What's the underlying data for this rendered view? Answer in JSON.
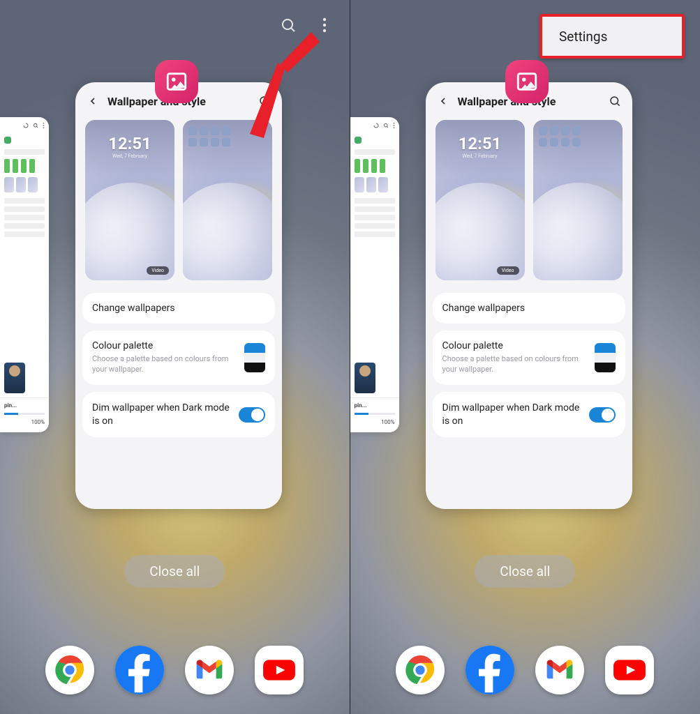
{
  "topbar": {
    "search_icon": "search",
    "more_icon": "more"
  },
  "popup": {
    "settings_label": "Settings"
  },
  "recents": {
    "app_icon_name": "gallery-icon",
    "close_all_label": "Close all",
    "card": {
      "title": "Wallpaper and style",
      "lock_time": "12:51",
      "lock_date": "Wed, 7 February",
      "video_badge": "Video",
      "change_wallpapers_label": "Change wallpapers",
      "colour_palette_label": "Colour palette",
      "colour_palette_desc": "Choose a palette based on colours from your wallpaper.",
      "palette_colors": [
        "#1a84d6",
        "#eef0f2",
        "#111111"
      ],
      "dim_label": "Dim wallpaper when Dark mode is on",
      "dim_enabled": true
    },
    "side_download": {
      "name": "pin...",
      "progress_percent": "100%"
    }
  },
  "dock": {
    "apps": [
      "chrome",
      "facebook",
      "gmail",
      "youtube"
    ]
  }
}
